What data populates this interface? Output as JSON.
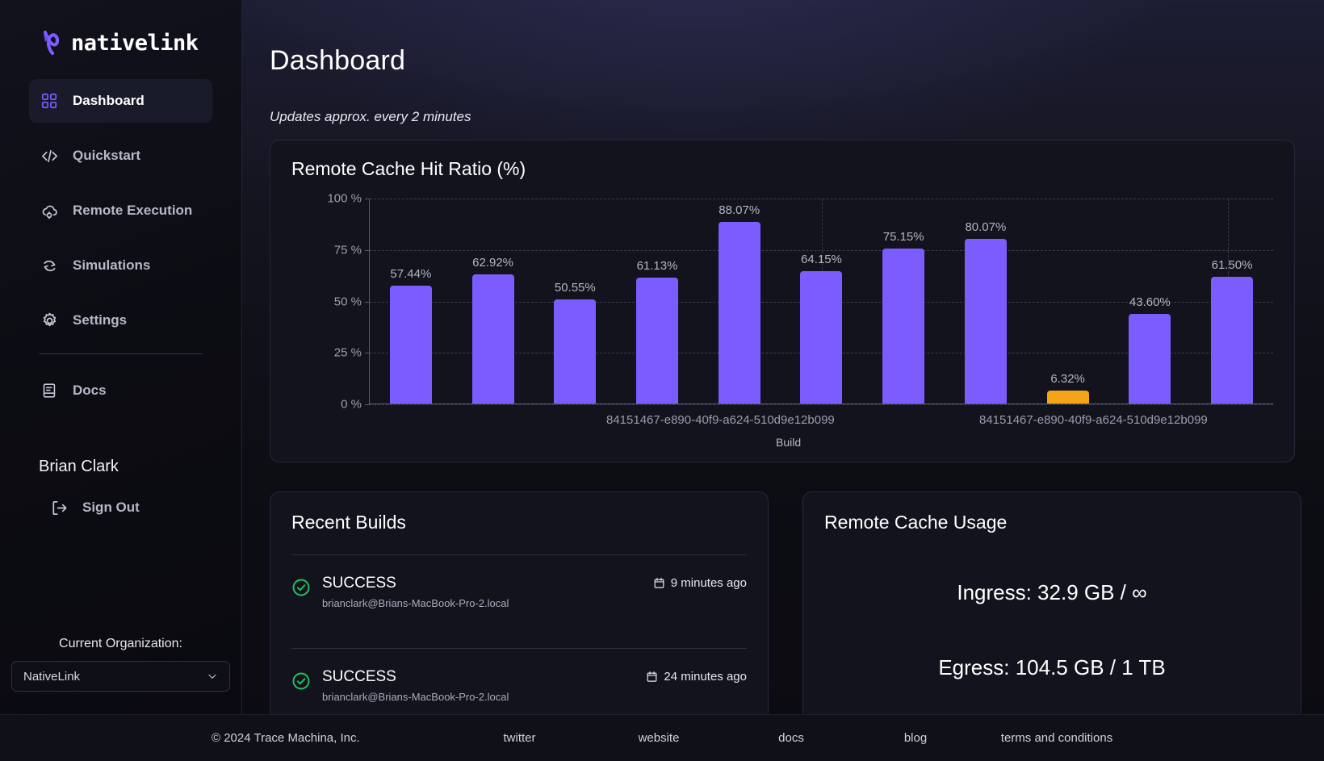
{
  "brand": {
    "name": "nativelink",
    "logo_icon": "nativelink-logo-icon"
  },
  "sidebar": {
    "items": [
      {
        "label": "Dashboard",
        "icon": "grid-icon",
        "active": true
      },
      {
        "label": "Quickstart",
        "icon": "code-brackets-icon",
        "active": false
      },
      {
        "label": "Remote Execution",
        "icon": "cloud-gear-icon",
        "active": false
      },
      {
        "label": "Simulations",
        "icon": "simulation-arrows-icon",
        "active": false
      },
      {
        "label": "Settings",
        "icon": "gear-icon",
        "active": false
      },
      {
        "label": "Docs",
        "icon": "book-icon",
        "active": false
      }
    ],
    "user_name": "Brian Clark",
    "sign_out_label": "Sign Out",
    "sign_out_icon": "sign-out-icon",
    "org_label": "Current Organization:",
    "org_value": "NativeLink",
    "org_chevron_icon": "chevron-down-icon"
  },
  "main": {
    "title": "Dashboard",
    "subtitle": "Updates approx. every 2 minutes"
  },
  "chart_card": {
    "title": "Remote Cache Hit Ratio (%)"
  },
  "chart_data": {
    "type": "bar",
    "title": "Remote Cache Hit Ratio (%)",
    "xlabel": "Build",
    "ylabel": "",
    "ylim": [
      0,
      100
    ],
    "yticks": [
      "0 %",
      "25 %",
      "50 %",
      "75 %",
      "100 %"
    ],
    "ytick_values": [
      0,
      25,
      50,
      75,
      100
    ],
    "grid": true,
    "legend": "none",
    "categories": [
      "84151467-e890-40f9-a624-510d9e12b099",
      "84151467-e890-40f9-a624-510d9e12b099",
      "84151467-e890-40f9-a624-510d9e12b099",
      "84151467-e890-40f9-a624-510d9e12b099",
      "84151467-e890-40f9-a624-510d9e12b099",
      "84151467-e890-40f9-a624-510d9e12b099",
      "84151467-e890-40f9-a624-510d9e12b099",
      "84151467-e890-40f9-a624-510d9e12b099",
      "84151467-e890-40f9-a624-510d9e12b099",
      "84151467-e890-40f9-a624-510d9e12b099",
      "84151467-e890-40f9-a624-510d9e12b099"
    ],
    "visible_xtick_labels": [
      "84151467-e890-40f9-a624-510d9e12b099",
      "84151467-e890-40f9-a624-510d9e12b099"
    ],
    "values": [
      57.44,
      62.92,
      50.55,
      61.13,
      88.07,
      64.15,
      75.15,
      80.07,
      6.32,
      43.6,
      61.5
    ],
    "labels": [
      "57.44%",
      "62.92%",
      "50.55%",
      "61.13%",
      "88.07%",
      "64.15%",
      "75.15%",
      "80.07%",
      "6.32%",
      "43.60%",
      "61.50%"
    ],
    "bar_colors": [
      "#7c5cff",
      "#7c5cff",
      "#7c5cff",
      "#7c5cff",
      "#7c5cff",
      "#7c5cff",
      "#7c5cff",
      "#7c5cff",
      "#f5a417",
      "#7c5cff",
      "#7c5cff"
    ]
  },
  "recent_builds": {
    "title": "Recent Builds",
    "rows": [
      {
        "status": "SUCCESS",
        "host": "brianclark@Brians-MacBook-Pro-2.local",
        "time": "9 minutes ago",
        "status_icon": "check-circle-icon",
        "time_icon": "calendar-icon"
      },
      {
        "status": "SUCCESS",
        "host": "brianclark@Brians-MacBook-Pro-2.local",
        "time": "24 minutes ago",
        "status_icon": "check-circle-icon",
        "time_icon": "calendar-icon"
      }
    ]
  },
  "cache_usage": {
    "title": "Remote Cache Usage",
    "ingress": "Ingress: 32.9 GB / ∞",
    "egress": "Egress: 104.5 GB / 1 TB"
  },
  "footer": {
    "copyright": "© 2024 Trace Machina, Inc.",
    "links": [
      "twitter",
      "website",
      "docs",
      "blog",
      "terms and conditions"
    ]
  },
  "colors": {
    "accent": "#7c5cff",
    "warning": "#f5a417",
    "success": "#22c55e",
    "panel": "#13131e",
    "sidebar": "#0c0c13"
  }
}
